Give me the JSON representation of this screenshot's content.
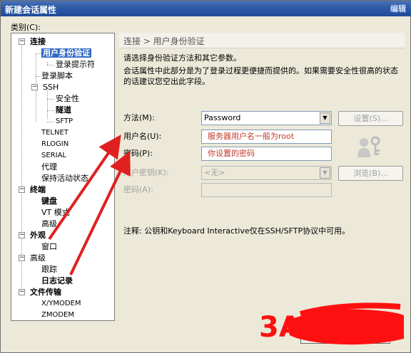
{
  "window": {
    "title": "新建会话属性",
    "corner_hint": "编辑"
  },
  "category_label": "类别(C):",
  "tree": {
    "items": [
      {
        "label": "连接"
      },
      {
        "label": "用户身份验证"
      },
      {
        "label": "登录提示符"
      },
      {
        "label": "登录脚本"
      },
      {
        "label": "SSH"
      },
      {
        "label": "安全性"
      },
      {
        "label": "隧道"
      },
      {
        "label": "SFTP"
      },
      {
        "label": "TELNET"
      },
      {
        "label": "RLOGIN"
      },
      {
        "label": "SERIAL"
      },
      {
        "label": "代理"
      },
      {
        "label": "保持活动状态"
      },
      {
        "label": "终端"
      },
      {
        "label": "键盘"
      },
      {
        "label": "VT 模式"
      },
      {
        "label": "高级"
      },
      {
        "label": "外观"
      },
      {
        "label": "窗口"
      },
      {
        "label": "高级"
      },
      {
        "label": "跟踪"
      },
      {
        "label": "日志记录"
      },
      {
        "label": "文件传输"
      },
      {
        "label": "X/YMODEM"
      },
      {
        "label": "ZMODEM"
      }
    ]
  },
  "panel": {
    "breadcrumb": "连接 > 用户身份验证",
    "intro": "请选择身份验证方法和其它参数。",
    "description": "会话属性中此部分是为了登录过程更便捷而提供的。如果需要安全性很高的状态的话建议您空出此字段。",
    "method_label": "方法(M):",
    "method_value": "Password",
    "settings_button": "设置(S)...",
    "username_label": "用户名(U):",
    "username_value": "服务器用户名一般为root",
    "password_label": "密码(P):",
    "password_value": "你设置的密码",
    "userkey_label": "用户密钥(K):",
    "userkey_value": "<无>",
    "browse_button": "浏览(B)...",
    "passphrase_label": "密码(A):",
    "note": "注释: 公钥和Keyboard Interactive仅在SSH/SFTP协议中可用。"
  },
  "footer": {
    "watermark": "3A"
  },
  "colors": {
    "annotation": "#e02020",
    "selection": "#316ac5",
    "titlebar": "#2e5aa6"
  }
}
